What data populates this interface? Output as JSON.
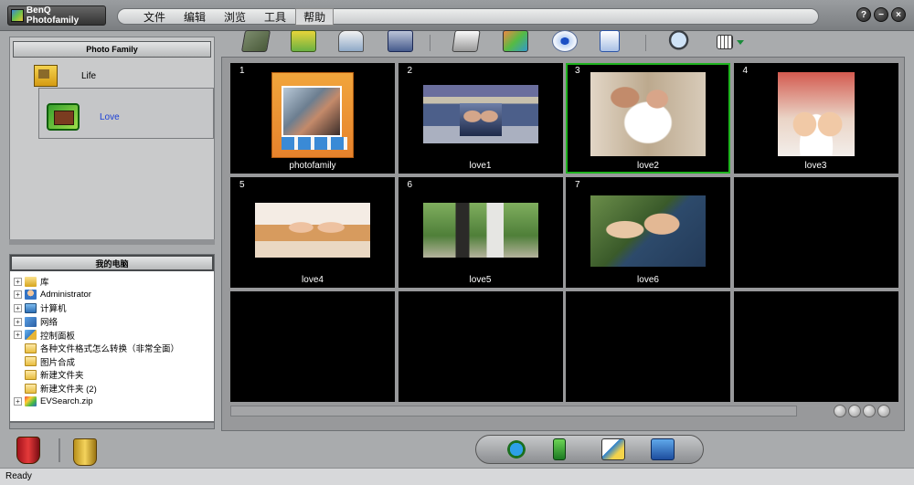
{
  "app": {
    "title": "BenQ Photofamily"
  },
  "menu": {
    "items": [
      "文件",
      "编辑",
      "浏览",
      "工具",
      "帮助"
    ]
  },
  "window_controls": {
    "help": "?",
    "minimize": "−",
    "close": "×"
  },
  "albums_panel": {
    "title": "Photo Family",
    "albums": [
      {
        "label": "Life",
        "icon": "folder-icon"
      },
      {
        "label": "Love",
        "icon": "album-icon",
        "selected": true
      }
    ]
  },
  "tree_panel": {
    "title": "我的电脑",
    "items": [
      {
        "label": "库",
        "expandable": true,
        "icon": "library-icon"
      },
      {
        "label": "Administrator",
        "expandable": true,
        "icon": "user-icon"
      },
      {
        "label": "计算机",
        "expandable": true,
        "icon": "computer-icon"
      },
      {
        "label": "网络",
        "expandable": true,
        "icon": "network-icon"
      },
      {
        "label": "控制面板",
        "expandable": true,
        "icon": "control-panel-icon"
      },
      {
        "label": "各种文件格式怎么转换（非常全面）",
        "expandable": false,
        "icon": "folder-icon"
      },
      {
        "label": "图片合成",
        "expandable": false,
        "icon": "folder-icon"
      },
      {
        "label": "新建文件夹",
        "expandable": false,
        "icon": "folder-icon"
      },
      {
        "label": "新建文件夹 (2)",
        "expandable": false,
        "icon": "folder-icon"
      },
      {
        "label": "EVSearch.zip",
        "expandable": true,
        "icon": "zip-icon"
      }
    ]
  },
  "toolbar": {
    "icons": [
      "photo-icon",
      "open-folder-icon",
      "scanner-icon",
      "save-icon",
      "print-icon",
      "edit-icon",
      "eye-icon",
      "document-icon",
      "magnifier-icon",
      "view-mode-icon"
    ]
  },
  "thumbnails": [
    {
      "number": "1",
      "name": "photofamily"
    },
    {
      "number": "2",
      "name": "love1"
    },
    {
      "number": "3",
      "name": "love2",
      "selected": true
    },
    {
      "number": "4",
      "name": "love3"
    },
    {
      "number": "5",
      "name": "love4"
    },
    {
      "number": "6",
      "name": "love5"
    },
    {
      "number": "7",
      "name": "love6"
    }
  ],
  "share_bar": {
    "icons": [
      "web-icon",
      "phone-icon",
      "mail-icon",
      "fax-icon"
    ]
  },
  "status": {
    "text": "Ready"
  },
  "colors": {
    "selection_border": "#1fb31f",
    "album_selected_text": "#1a3fd6",
    "grid_background": "#000000"
  }
}
